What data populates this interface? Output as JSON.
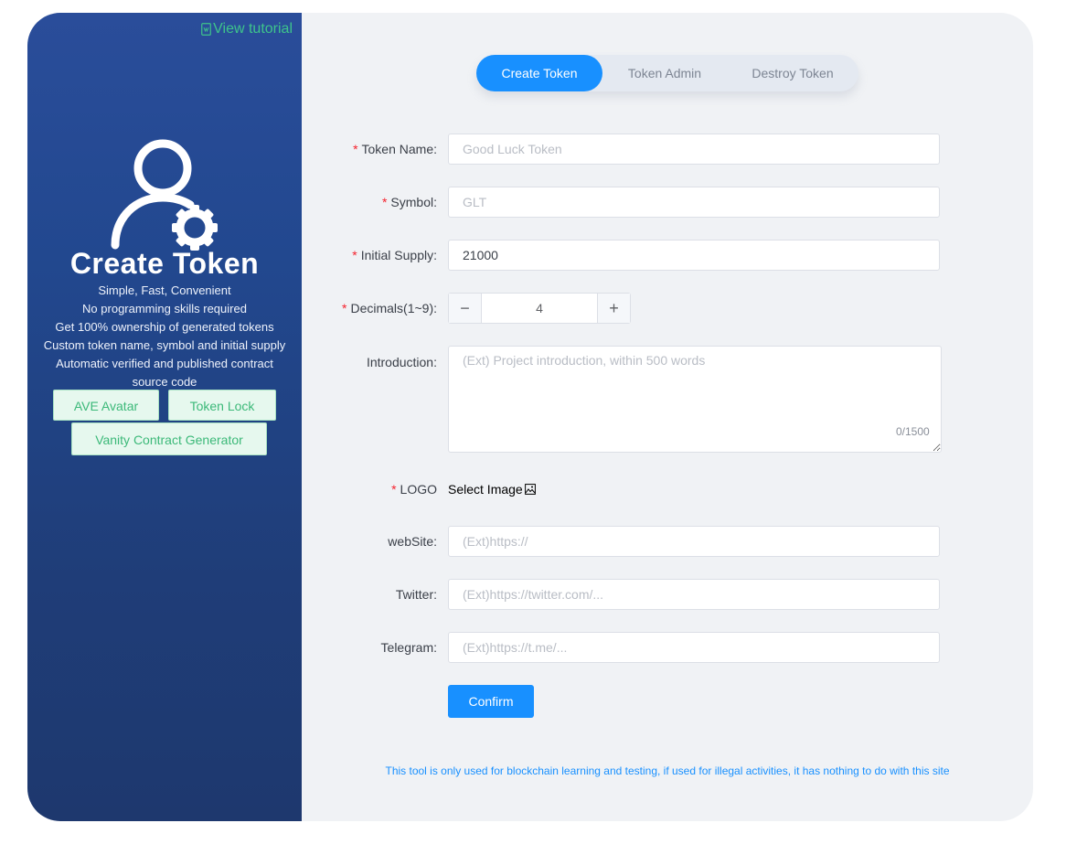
{
  "sidebar": {
    "tutorial_label": "View tutorial",
    "title": "Create Token",
    "features": [
      "Simple, Fast, Convenient",
      "No programming skills required",
      "Get 100% ownership of generated tokens",
      "Custom token name, symbol and initial supply",
      "Automatic verified and published contract source code"
    ],
    "links": [
      "AVE Avatar",
      "Token Lock",
      "Vanity Contract Generator"
    ],
    "icons": {
      "tutorial": "document-icon",
      "hero": "user-gear-icon"
    }
  },
  "tabs": [
    "Create Token",
    "Token Admin",
    "Destroy Token"
  ],
  "active_tab": "Create Token",
  "form": {
    "token_name": {
      "label": "Token Name:",
      "required": true,
      "value": "",
      "placeholder": "Good Luck Token"
    },
    "symbol": {
      "label": "Symbol:",
      "required": true,
      "value": "",
      "placeholder": "GLT"
    },
    "initial_supply": {
      "label": "Initial Supply:",
      "required": true,
      "value": "21000",
      "placeholder": ""
    },
    "decimals": {
      "label": "Decimals(1~9):",
      "required": true,
      "value": "4",
      "minus": "−",
      "plus": "+"
    },
    "introduction": {
      "label": "Introduction:",
      "required": false,
      "value": "",
      "placeholder": "(Ext) Project introduction, within 500 words",
      "counter": "0/1500"
    },
    "logo": {
      "label": "LOGO",
      "required": true,
      "action": "Select Image",
      "icon": "image-icon"
    },
    "website": {
      "label": "webSite:",
      "required": false,
      "value": "",
      "placeholder": "(Ext)https://"
    },
    "twitter": {
      "label": "Twitter:",
      "required": false,
      "value": "",
      "placeholder": "(Ext)https://twitter.com/..."
    },
    "telegram": {
      "label": "Telegram:",
      "required": false,
      "value": "",
      "placeholder": "(Ext)https://t.me/..."
    },
    "confirm_label": "Confirm",
    "required_mark": "*"
  },
  "disclaimer": "This tool is only used for blockchain learning and testing, if used for illegal activities, it has nothing to do with this site",
  "colors": {
    "accent": "#1890ff",
    "green": "#3ec48b",
    "required": "#f5222d",
    "sidebar": "#22488f"
  }
}
